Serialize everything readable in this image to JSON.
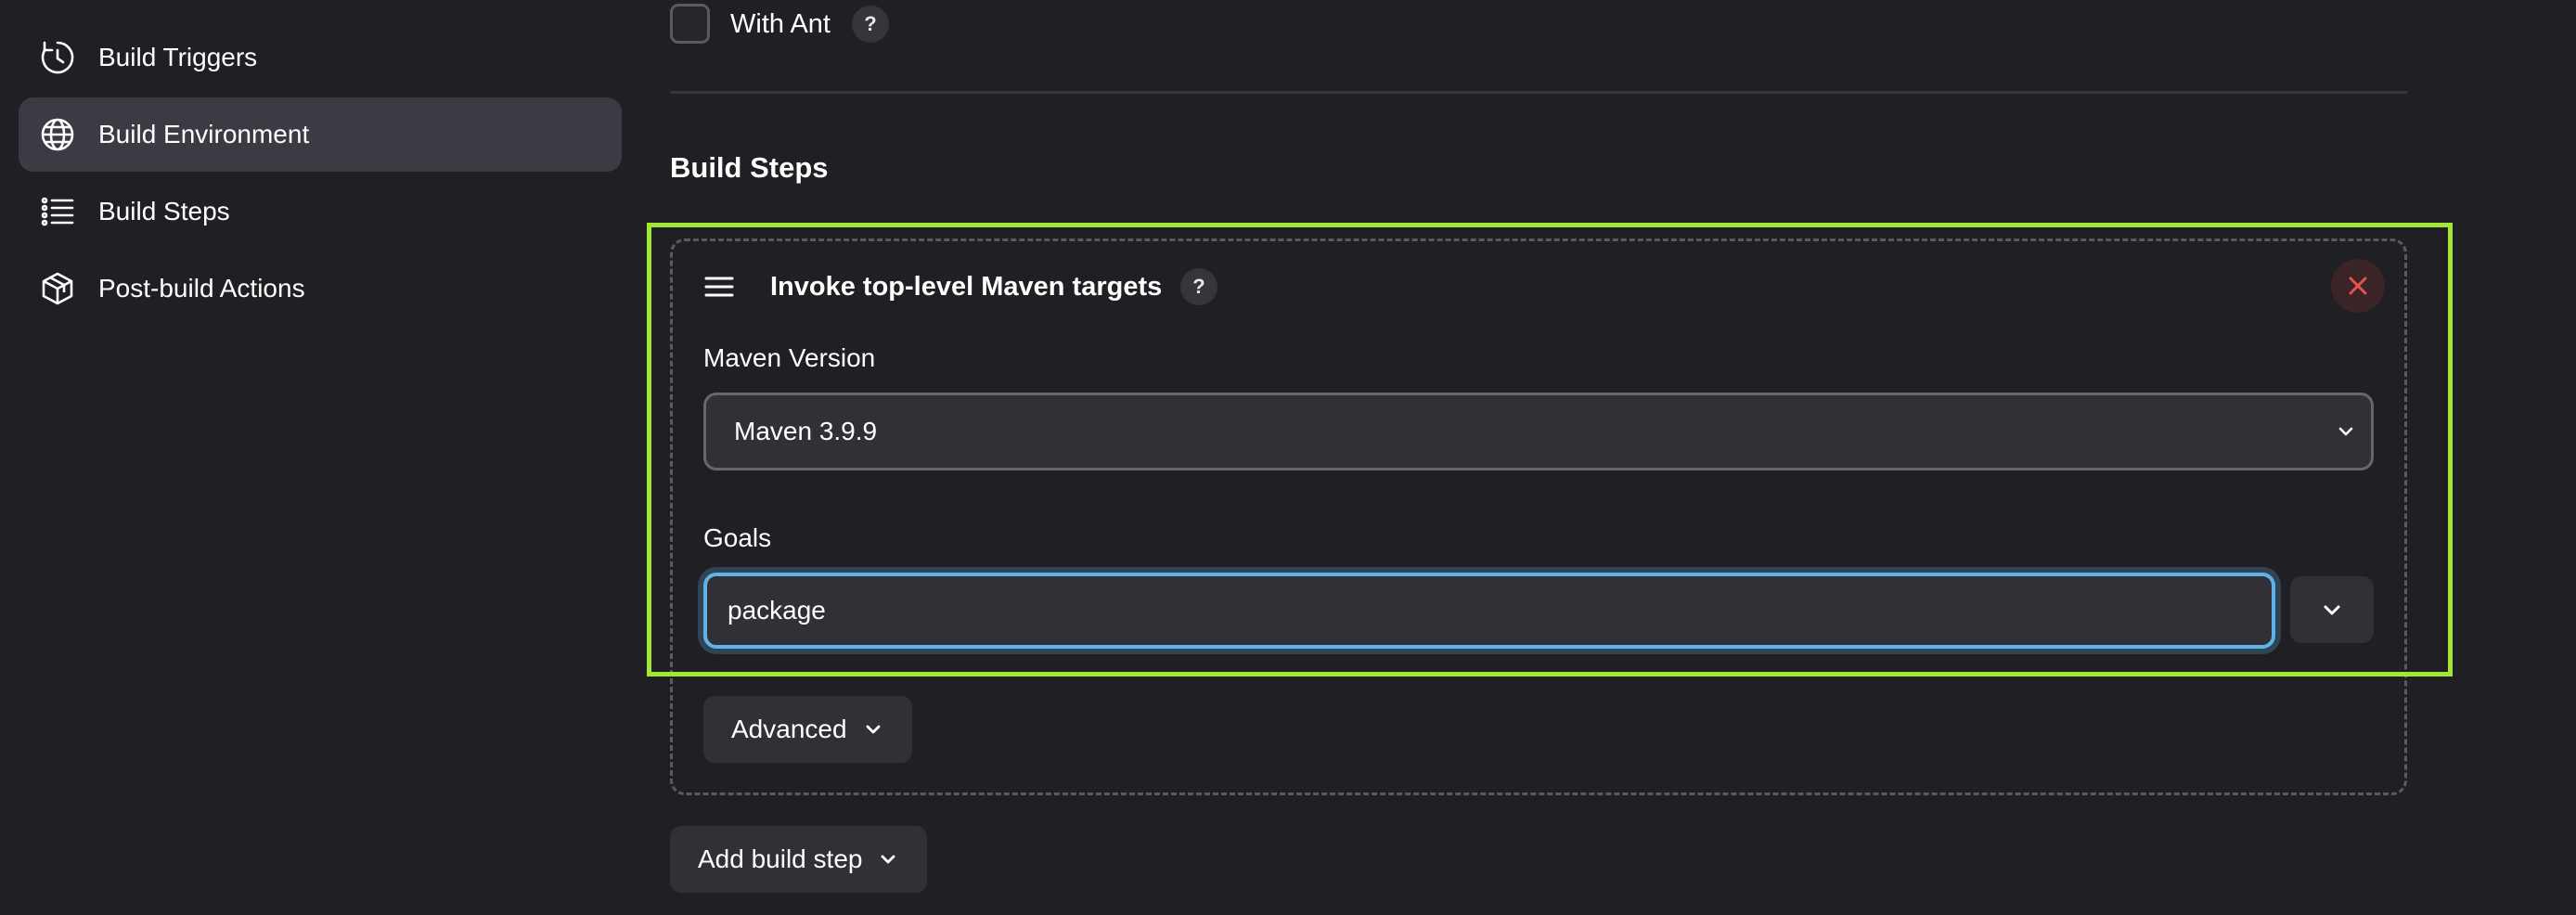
{
  "sidebar": {
    "items": [
      {
        "label": "Build Triggers",
        "icon": "clock-icon"
      },
      {
        "label": "Build Environment",
        "icon": "globe-icon",
        "active": true
      },
      {
        "label": "Build Steps",
        "icon": "list-icon"
      },
      {
        "label": "Post-build Actions",
        "icon": "package-icon"
      }
    ]
  },
  "with_ant": {
    "label": "With Ant",
    "checked": false,
    "help": "?"
  },
  "build_steps": {
    "title": "Build Steps",
    "step": {
      "title": "Invoke top-level Maven targets",
      "help": "?",
      "maven_version": {
        "label": "Maven Version",
        "selected": "Maven 3.9.9"
      },
      "goals": {
        "label": "Goals",
        "value": "package"
      },
      "advanced_label": "Advanced"
    },
    "add_step_label": "Add build step"
  },
  "colors": {
    "background": "#1f1f24",
    "highlight": "#a3e635",
    "focus": "#60b3e8",
    "delete": "#e5534b"
  }
}
